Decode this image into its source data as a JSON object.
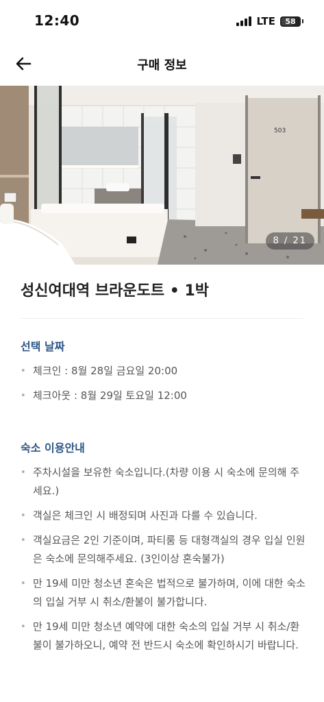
{
  "status_bar": {
    "time": "12:40",
    "network": "LTE",
    "battery": "58",
    "battery_level": 0.58
  },
  "header": {
    "title": "구매 정보",
    "back_icon": "arrow-left-icon"
  },
  "hero": {
    "photo_counter": "8 / 21",
    "door_number": "503"
  },
  "product": {
    "title": "성신여대역 브라운도트 • 1박"
  },
  "dates": {
    "section_title": "선택 날짜",
    "items": [
      "체크인 : 8월 28일 금요일 20:00",
      "체크아웃 : 8월 29일 토요일 12:00"
    ]
  },
  "info": {
    "section_title": "숙소 이용안내",
    "items": [
      "주차시설을 보유한 숙소입니다.(차량 이용 시 숙소에 문의해 주세요.)",
      "객실은 체크인 시 배정되며 사진과 다를 수 있습니다.",
      "객실요금은 2인 기준이며, 파티룸 등 대형객실의 경우 입실 인원은 숙소에 문의해주세요. (3인이상 혼숙불가)",
      "만 19세 미만 청소년 혼숙은 법적으로 불가하며, 이에 대한 숙소의 입실 거부 시 취소/환불이 불가합니다.",
      "만 19세 미만 청소년 예약에 대한 숙소의 입실 거부 시 취소/환불이 불가하오니, 예약 전 반드시 숙소에 확인하시기 바랍니다."
    ]
  },
  "colors": {
    "section_title": "#2d5584",
    "text": "#555555",
    "title": "#222222"
  }
}
